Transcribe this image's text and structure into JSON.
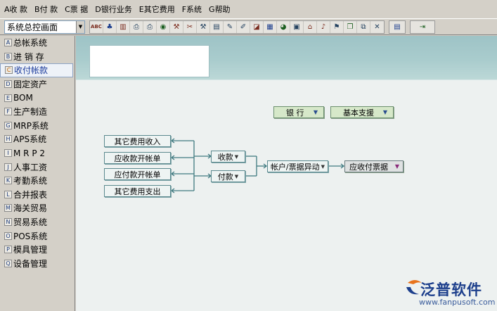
{
  "menu": {
    "items": [
      {
        "key": "A",
        "label": "收 款"
      },
      {
        "key": "B",
        "label": "付 款"
      },
      {
        "key": "C",
        "label": "票 据"
      },
      {
        "key": "D",
        "label": "银行业务"
      },
      {
        "key": "E",
        "label": "其它费用"
      },
      {
        "key": "F",
        "label": "系统"
      },
      {
        "key": "G",
        "label": "帮助"
      }
    ]
  },
  "toolbar": {
    "view_select": "系统总控画面",
    "buttons": [
      {
        "icon": "abc-icon",
        "glyph": "ABC"
      },
      {
        "icon": "users-icon",
        "glyph": "♣"
      },
      {
        "icon": "books-icon",
        "glyph": "▥"
      },
      {
        "icon": "printer-icon",
        "glyph": "⎙"
      },
      {
        "icon": "printer-alt-icon",
        "glyph": "⎙"
      },
      {
        "icon": "globe-icon",
        "glyph": "◉"
      },
      {
        "icon": "tools-icon",
        "glyph": "⚒"
      },
      {
        "icon": "scissors-icon",
        "glyph": "✂"
      },
      {
        "icon": "hammer-icon",
        "glyph": "⚒"
      },
      {
        "icon": "document-icon",
        "glyph": "▤"
      },
      {
        "icon": "pen-icon",
        "glyph": "✎"
      },
      {
        "icon": "pencil-icon",
        "glyph": "✐"
      },
      {
        "icon": "eraser-icon",
        "glyph": "◪"
      },
      {
        "icon": "grid-icon",
        "glyph": "▦"
      },
      {
        "icon": "chart-icon",
        "glyph": "◕"
      },
      {
        "icon": "window-icon",
        "glyph": "▣"
      },
      {
        "icon": "building-icon",
        "glyph": "⌂"
      },
      {
        "icon": "sound-icon",
        "glyph": "♪"
      },
      {
        "icon": "bookmark-icon",
        "glyph": "⚑"
      },
      {
        "icon": "copy-icon",
        "glyph": "❐"
      },
      {
        "icon": "cascade-icon",
        "glyph": "⧉"
      },
      {
        "icon": "close-icon",
        "glyph": "✕"
      }
    ],
    "extra_buttons": [
      {
        "icon": "layout-icon",
        "glyph": "▤"
      },
      {
        "icon": "exit-icon",
        "glyph": "⇥"
      }
    ]
  },
  "sidebar": {
    "items": [
      {
        "key": "A",
        "label": "总帐系统",
        "active": false
      },
      {
        "key": "B",
        "label": "进 销 存",
        "active": false
      },
      {
        "key": "C",
        "label": "收付帐款",
        "active": true
      },
      {
        "key": "D",
        "label": "固定资产",
        "active": false
      },
      {
        "key": "E",
        "label": "BOM",
        "active": false
      },
      {
        "key": "F",
        "label": "生产制造",
        "active": false
      },
      {
        "key": "G",
        "label": "MRP系统",
        "active": false
      },
      {
        "key": "H",
        "label": "APS系统",
        "active": false
      },
      {
        "key": "I",
        "label": "M R P 2",
        "active": false
      },
      {
        "key": "J",
        "label": "人事工资",
        "active": false
      },
      {
        "key": "K",
        "label": "考勤系统",
        "active": false
      },
      {
        "key": "L",
        "label": "合并报表",
        "active": false
      },
      {
        "key": "M",
        "label": "海关贸易",
        "active": false
      },
      {
        "key": "N",
        "label": "贸易系统",
        "active": false
      },
      {
        "key": "O",
        "label": "POS系统",
        "active": false
      },
      {
        "key": "P",
        "label": "模具管理",
        "active": false
      },
      {
        "key": "Q",
        "label": "设备管理",
        "active": false
      }
    ]
  },
  "flow": {
    "bank_dropdown": "银 行",
    "support_dropdown": "基本支援",
    "other_income": "其它费用收入",
    "ar_billing": "应收款开帐单",
    "ap_billing": "应付款开帐单",
    "other_expense": "其它费用支出",
    "receipt": "收款",
    "payment": "付款",
    "account_note_change": "帐户/票据异动",
    "ar_ap_notes": "应收付票据"
  },
  "brand": {
    "name": "泛普软件",
    "url": "www.fanpusoft.com"
  },
  "colors": {
    "header_teal": "#9ec3c6",
    "canvas": "#edf1f0",
    "dropdown_green": "#d6e8c9",
    "line": "#3f7a80",
    "brand_blue": "#1d3f8c",
    "brand_orange": "#e8731c"
  }
}
